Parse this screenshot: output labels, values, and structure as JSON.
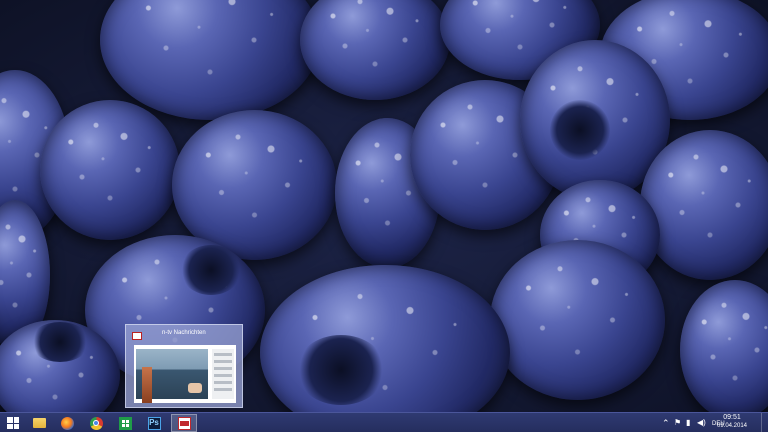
{
  "taskbar": {
    "apps": [
      {
        "name": "file-explorer",
        "icon": "folder-icon"
      },
      {
        "name": "firefox",
        "icon": "firefox-icon"
      },
      {
        "name": "chrome",
        "icon": "chrome-icon"
      },
      {
        "name": "store",
        "icon": "store-icon"
      },
      {
        "name": "photoshop",
        "icon": "photoshop-icon",
        "label": "Ps"
      },
      {
        "name": "n-tv",
        "icon": "ntv-icon",
        "active": true
      }
    ],
    "tray": {
      "language": "DEU",
      "time": "09:51",
      "date": "09.04.2014"
    }
  },
  "preview": {
    "title": "n-tv Nachrichten"
  },
  "colors": {
    "taskbar": "#2a3468",
    "preview_bg": "#96a0d2"
  }
}
